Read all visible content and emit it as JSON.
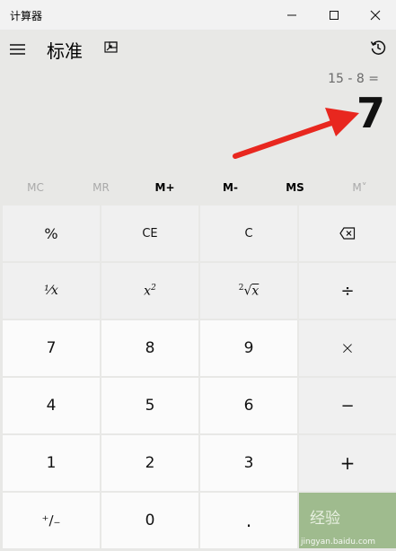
{
  "window": {
    "app_name": "计算器",
    "minimize_icon": "minimize-icon",
    "maximize_icon": "maximize-icon",
    "close_icon": "close-icon"
  },
  "header": {
    "menu_icon": "hamburger-menu-icon",
    "mode_title": "标准",
    "overlay_icon": "keep-on-top-icon",
    "history_icon": "history-icon"
  },
  "display": {
    "expression": "15 - 8 =",
    "result": "7",
    "annotation": "red-arrow"
  },
  "memory": {
    "buttons": [
      {
        "label": "MC",
        "enabled": false
      },
      {
        "label": "MR",
        "enabled": false
      },
      {
        "label": "M+",
        "enabled": true
      },
      {
        "label": "M-",
        "enabled": true
      },
      {
        "label": "MS",
        "enabled": true
      },
      {
        "label": "M˅",
        "enabled": false
      }
    ]
  },
  "keypad": {
    "percent": "%",
    "clear_entry": "CE",
    "clear": "C",
    "backspace_icon": "backspace-icon",
    "reciprocal": "¹⁄x",
    "square_base": "x",
    "square_exp": "2",
    "sqrt_index": "2",
    "sqrt_radicand": "x",
    "divide": "÷",
    "seven": "7",
    "eight": "8",
    "nine": "9",
    "multiply": "×",
    "four": "4",
    "five": "5",
    "six": "6",
    "subtract": "−",
    "one": "1",
    "two": "2",
    "three": "3",
    "add": "+",
    "negate": "⁺∕₋",
    "zero": "0",
    "decimal": ".",
    "equals_watermark": "经验",
    "equals_url": "jingyan.baidu.com"
  },
  "colors": {
    "background": "#e8e8e6",
    "annotation_arrow": "#e8271f",
    "equals_key": "#9fbb8e"
  }
}
